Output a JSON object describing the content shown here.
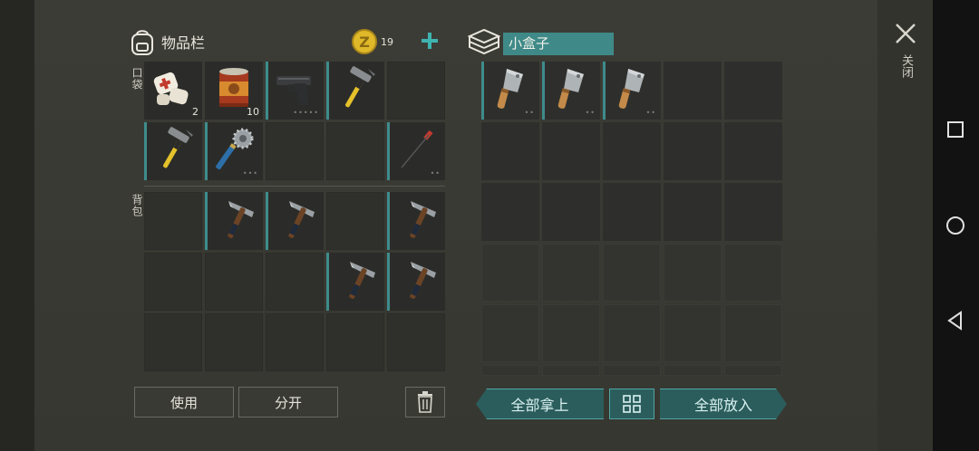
{
  "inventory": {
    "title": "物品栏",
    "coins": "19",
    "pocket_label": "口袋",
    "backpack_label": "背包",
    "pocket_slots": [
      {
        "item": "medkit",
        "qty": "2",
        "dots": "",
        "equip": false
      },
      {
        "item": "canned-food",
        "qty": "10",
        "dots": "",
        "equip": false
      },
      {
        "item": "pistol",
        "qty": "",
        "dots": "•••••",
        "equip": true
      },
      {
        "item": "hammer",
        "qty": "",
        "dots": "",
        "equip": true
      },
      {
        "item": "",
        "qty": "",
        "dots": "",
        "equip": false
      },
      {
        "item": "hammer",
        "qty": "",
        "dots": "",
        "equip": true
      },
      {
        "item": "spiked-club",
        "qty": "",
        "dots": "•••",
        "equip": true
      },
      {
        "item": "",
        "qty": "",
        "dots": "",
        "equip": false
      },
      {
        "item": "",
        "qty": "",
        "dots": "",
        "equip": false
      },
      {
        "item": "crowbar",
        "qty": "",
        "dots": "••",
        "equip": true
      }
    ],
    "backpack_slots": [
      {
        "item": "",
        "equip": false
      },
      {
        "item": "pickaxe",
        "equip": true
      },
      {
        "item": "pickaxe",
        "equip": true
      },
      {
        "item": "",
        "equip": false
      },
      {
        "item": "pickaxe",
        "equip": true
      },
      {
        "item": "",
        "equip": false
      },
      {
        "item": "",
        "equip": false
      },
      {
        "item": "",
        "equip": false
      },
      {
        "item": "pickaxe",
        "equip": true
      },
      {
        "item": "pickaxe",
        "equip": true
      },
      {
        "item": "",
        "equip": false
      },
      {
        "item": "",
        "equip": false
      },
      {
        "item": "",
        "equip": false
      },
      {
        "item": "",
        "equip": false
      },
      {
        "item": "",
        "equip": false
      }
    ],
    "buttons": {
      "use": "使用",
      "split": "分开"
    }
  },
  "box": {
    "name": "小盒子",
    "slots_filled": [
      {
        "item": "cleaver",
        "dots": "••"
      },
      {
        "item": "cleaver",
        "dots": "••"
      },
      {
        "item": "cleaver",
        "dots": "••"
      }
    ],
    "buttons": {
      "take_all": "全部拿上",
      "put_all": "全部放入"
    }
  },
  "close_label": "关闭",
  "colors": {
    "accent": "#3f8a88",
    "equip_bar": "#3e8c8c",
    "coin": "#e0b92a"
  }
}
